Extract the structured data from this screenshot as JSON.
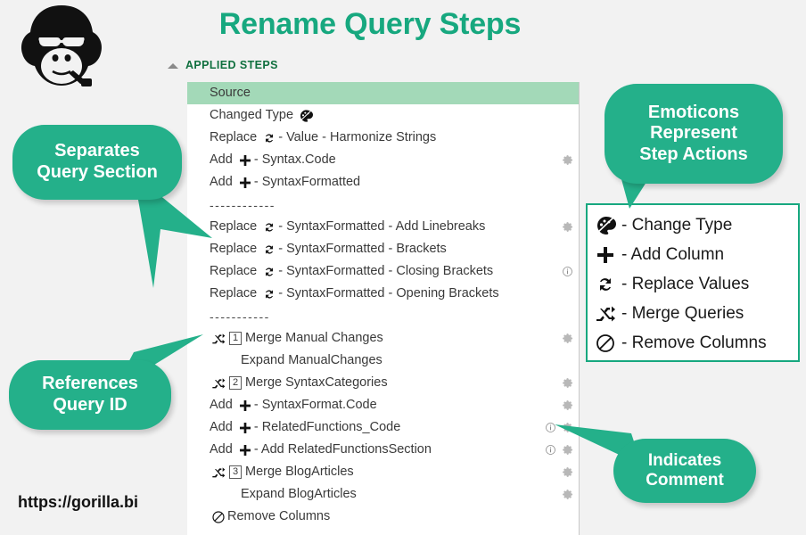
{
  "page": {
    "title": "Rename Query Steps",
    "site_url": "https://gorilla.bi",
    "accent_color": "#17a87f",
    "bubble_color": "#24b08a",
    "selected_row_color": "#a3d9b8",
    "logo_icon": "gorilla-head-icon"
  },
  "steps_panel": {
    "header_label": "APPLIED STEPS",
    "collapse_icon": "triangle-collapse-icon",
    "steps": [
      {
        "text": "Source",
        "selected": true,
        "indent": false,
        "glyph": null,
        "qid": null,
        "separator": false,
        "info": false,
        "gear": false
      },
      {
        "text": "Changed Type",
        "trailing_glyph": "change-type",
        "selected": false,
        "indent": false,
        "glyph": null,
        "qid": null,
        "separator": false,
        "info": false,
        "gear": false
      },
      {
        "prefix": "Replace",
        "glyph": "replace-values",
        "text": " - Value - Harmonize Strings",
        "selected": false,
        "indent": false,
        "qid": null,
        "separator": false,
        "info": false,
        "gear": false
      },
      {
        "prefix": "Add",
        "glyph": "add-column",
        "text": " - Syntax.Code",
        "selected": false,
        "indent": false,
        "qid": null,
        "separator": false,
        "info": false,
        "gear": true
      },
      {
        "prefix": "Add",
        "glyph": "add-column",
        "text": " - SyntaxFormatted",
        "selected": false,
        "indent": false,
        "qid": null,
        "separator": false,
        "info": false,
        "gear": false
      },
      {
        "text": "------------",
        "separator": true,
        "selected": false,
        "indent": false,
        "glyph": null,
        "qid": null,
        "info": false,
        "gear": false
      },
      {
        "prefix": "Replace",
        "glyph": "replace-values",
        "text": " - SyntaxFormatted - Add Linebreaks",
        "selected": false,
        "indent": false,
        "qid": null,
        "separator": false,
        "info": false,
        "gear": true
      },
      {
        "prefix": "Replace",
        "glyph": "replace-values",
        "text": " - SyntaxFormatted - Brackets",
        "selected": false,
        "indent": false,
        "qid": null,
        "separator": false,
        "info": false,
        "gear": false
      },
      {
        "prefix": "Replace",
        "glyph": "replace-values",
        "text": " - SyntaxFormatted - Closing Brackets",
        "selected": false,
        "indent": false,
        "qid": null,
        "separator": false,
        "info": true,
        "gear": false
      },
      {
        "prefix": "Replace",
        "glyph": "replace-values",
        "text": " - SyntaxFormatted - Opening Brackets",
        "selected": false,
        "indent": false,
        "qid": null,
        "separator": false,
        "info": false,
        "gear": false
      },
      {
        "text": "-----------",
        "separator": true,
        "selected": false,
        "indent": false,
        "glyph": null,
        "qid": null,
        "info": false,
        "gear": false
      },
      {
        "prefix": "",
        "glyph": "merge-queries",
        "qid": "1",
        "text": "Merge Manual Changes",
        "selected": false,
        "indent": false,
        "separator": false,
        "info": false,
        "gear": true
      },
      {
        "text": "Expand ManualChanges",
        "selected": false,
        "indent": true,
        "glyph": null,
        "qid": null,
        "separator": false,
        "info": false,
        "gear": false
      },
      {
        "prefix": "",
        "glyph": "merge-queries",
        "qid": "2",
        "text": "Merge SyntaxCategories",
        "selected": false,
        "indent": false,
        "separator": false,
        "info": false,
        "gear": true
      },
      {
        "prefix": "Add",
        "glyph": "add-column",
        "text": " - SyntaxFormat.Code",
        "selected": false,
        "indent": false,
        "qid": null,
        "separator": false,
        "info": false,
        "gear": true
      },
      {
        "prefix": "Add",
        "glyph": "add-column",
        "text": " - RelatedFunctions_Code",
        "selected": false,
        "indent": false,
        "qid": null,
        "separator": false,
        "info": true,
        "gear": true
      },
      {
        "prefix": "Add",
        "glyph": "add-column",
        "text": " - Add RelatedFunctionsSection",
        "selected": false,
        "indent": false,
        "qid": null,
        "separator": false,
        "info": true,
        "gear": true
      },
      {
        "prefix": "",
        "glyph": "merge-queries",
        "qid": "3",
        "text": "Merge BlogArticles",
        "selected": false,
        "indent": false,
        "separator": false,
        "info": false,
        "gear": true
      },
      {
        "text": "Expand BlogArticles",
        "selected": false,
        "indent": true,
        "glyph": null,
        "qid": null,
        "separator": false,
        "info": false,
        "gear": true
      },
      {
        "prefix": "",
        "glyph": "remove-columns",
        "text": "Remove Columns",
        "selected": false,
        "indent": false,
        "qid": null,
        "separator": false,
        "info": false,
        "gear": false
      }
    ]
  },
  "legend": {
    "items": [
      {
        "icon": "change-type-icon",
        "label": "- Change Type"
      },
      {
        "icon": "add-column-icon",
        "label": "- Add Column"
      },
      {
        "icon": "replace-values-icon",
        "label": "- Replace Values"
      },
      {
        "icon": "merge-queries-icon",
        "label": "- Merge Queries"
      },
      {
        "icon": "remove-columns-icon",
        "label": "- Remove Columns"
      }
    ]
  },
  "callouts": {
    "separates": "Separates\nQuery Section",
    "references": "References\nQuery ID",
    "emoticons": "Emoticons\nRepresent\nStep Actions",
    "comment": "Indicates\nComment"
  }
}
